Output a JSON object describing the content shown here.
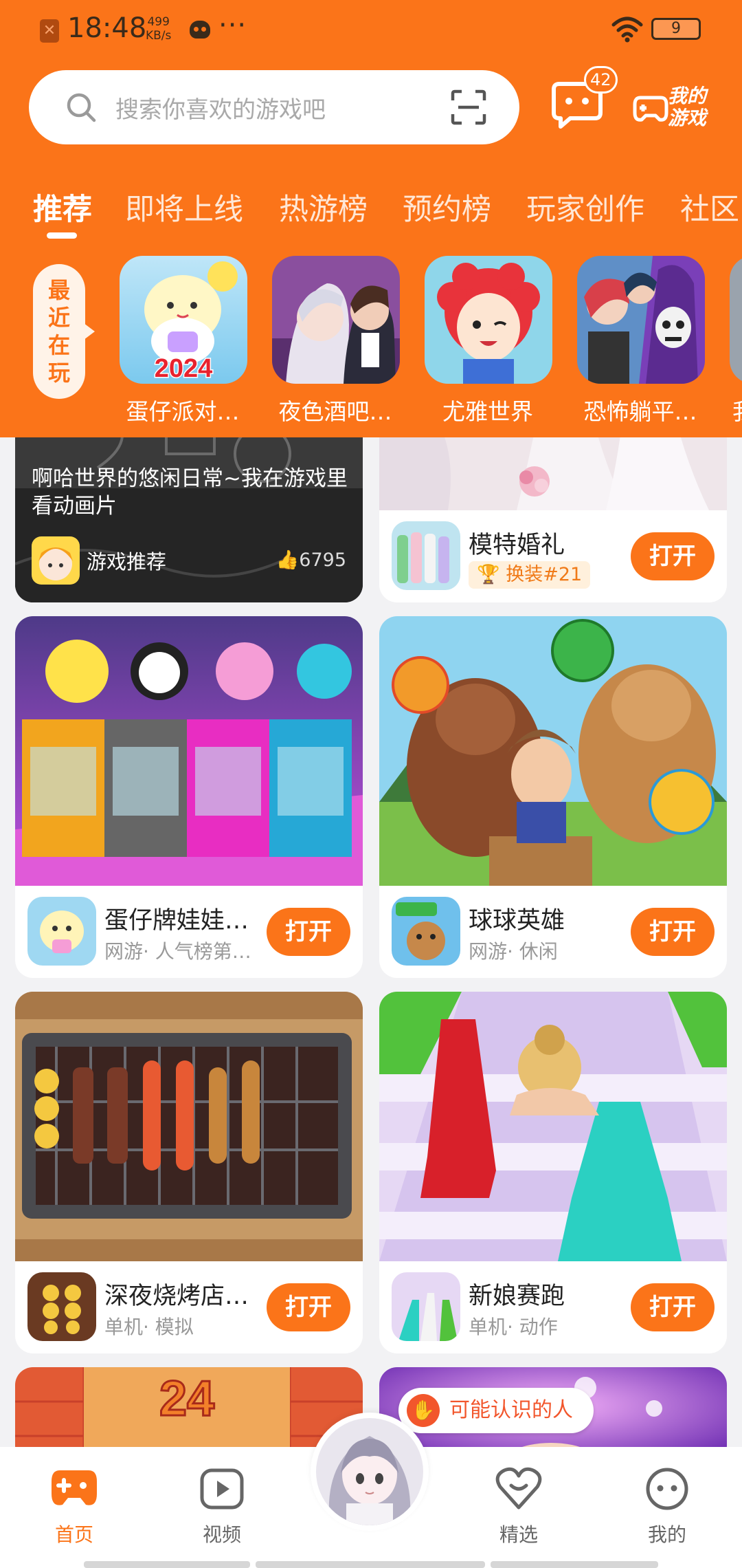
{
  "status_bar": {
    "time": "18:48",
    "net_speed_value": "499",
    "net_speed_unit": "KB/s",
    "more": "···",
    "battery": "9"
  },
  "search": {
    "placeholder": "搜索你喜欢的游戏吧"
  },
  "messages": {
    "badge_count": "42"
  },
  "my_games": {
    "label": "我的游戏"
  },
  "tabs": [
    {
      "label": "推荐",
      "active": true
    },
    {
      "label": "即将上线"
    },
    {
      "label": "热游榜"
    },
    {
      "label": "预约榜"
    },
    {
      "label": "玩家创作"
    },
    {
      "label": "社区"
    }
  ],
  "recent": {
    "label": "最近在玩",
    "games": [
      {
        "name": "蛋仔派对…",
        "badge": "2024"
      },
      {
        "name": "夜色酒吧…"
      },
      {
        "name": "尤雅世界"
      },
      {
        "name": "恐怖躺平…"
      },
      {
        "name": "我"
      }
    ]
  },
  "feed": {
    "video": {
      "title": "啊哈世界的悠闲日常~我在游戏里看动画片",
      "author": "游戏推荐",
      "likes": "6795"
    },
    "wedding": {
      "name": "模特婚礼",
      "rank": "换装#21",
      "button": "打开"
    },
    "games": [
      {
        "name": "蛋仔牌娃娃…",
        "meta": "网游· 人气榜第…",
        "button": "打开"
      },
      {
        "name": "球球英雄",
        "meta": "网游· 休闲",
        "button": "打开"
      },
      {
        "name": "深夜烧烤店…",
        "meta": "单机· 模拟",
        "button": "打开"
      },
      {
        "name": "新娘赛跑",
        "meta": "单机· 动作",
        "button": "打开"
      }
    ],
    "puzzle_number": "24",
    "friend_tip": "可能认识的人"
  },
  "bottom_nav": {
    "items": [
      {
        "label": "首页",
        "active": true
      },
      {
        "label": "视频"
      },
      {
        "label": "精选"
      },
      {
        "label": "我的"
      }
    ]
  },
  "colors": {
    "brand_orange": "#fb7419",
    "feed_background": "#f2f2f4",
    "meta_gray": "#999999",
    "friend_tip_red": "#f2562c"
  }
}
